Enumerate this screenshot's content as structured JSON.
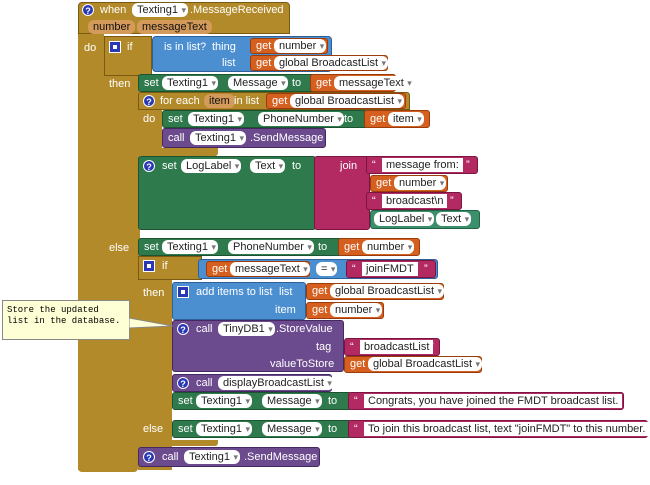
{
  "event": {
    "when": "when",
    "component": "Texting1",
    "event": ".MessageReceived",
    "params": [
      "number",
      "messageText"
    ]
  },
  "kw": {
    "do": "do",
    "if": "if",
    "then": "then",
    "else": "else",
    "is_in_list": "is in list?",
    "thing": "thing",
    "list": "list",
    "get": "get",
    "set": "set",
    "to": "to",
    "for_each": "for each",
    "item": "item",
    "in_list": "in list",
    "call": "call",
    "join": "join",
    "add_items": "add items to list",
    "list2": "list",
    "item2": "item",
    "tag": "tag",
    "value_to_store": "valueToStore",
    "eq": "="
  },
  "vars": {
    "number": "number",
    "message_text": "messageText",
    "broadcast_list": "global BroadcastList",
    "item": "item"
  },
  "comps": {
    "texting": "Texting1",
    "log_label": "LogLabel",
    "tinydb": "TinyDB1"
  },
  "props": {
    "message": "Message",
    "phone": "PhoneNumber",
    "text": "Text"
  },
  "methods": {
    "send": ".SendMessage",
    "store": ".StoreValue",
    "display": "displayBroadcastList"
  },
  "strings": {
    "msg_from": "message from: ",
    "broadcast_nl": "broadcast\\n ",
    "join_fmdt": "joinFMDT",
    "tag": "broadcastList",
    "congrats": "Congrats, you have joined the FMDT broadcast list.",
    "to_join": "To join this broadcast list, text \"joinFMDT\" to this number."
  },
  "comment": "Store the updated list in the database.",
  "colors": {
    "event": "#b28a2a",
    "text": "#2f7a4c",
    "var": "#d45f1e",
    "list": "#4c8fd1",
    "proc": "#6b4a8d",
    "string": "#b22a61"
  }
}
